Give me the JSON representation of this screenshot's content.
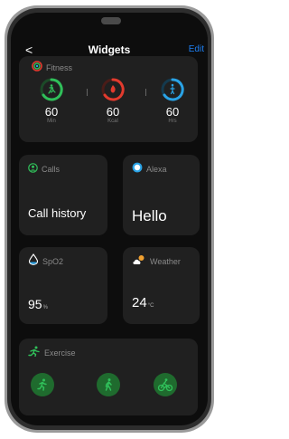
{
  "header": {
    "back_label": "<",
    "title": "Widgets",
    "edit_label": "Edit"
  },
  "fitness": {
    "label": "Fitness",
    "metrics": [
      {
        "name": "steps",
        "value": "60",
        "unit": "Min",
        "color": "#30c05a",
        "icon": "running-icon"
      },
      {
        "name": "calories",
        "value": "60",
        "unit": "Kcal",
        "color": "#e23b2e",
        "icon": "flame-icon"
      },
      {
        "name": "stand",
        "value": "60",
        "unit": "Hrs",
        "color": "#2aa3e6",
        "icon": "standing-icon"
      }
    ]
  },
  "calls": {
    "label": "Calls",
    "text": "Call history"
  },
  "alexa": {
    "label": "Alexa",
    "text": "Hello"
  },
  "spo2": {
    "label": "SpO2",
    "value": "95",
    "unit": "%"
  },
  "weather": {
    "label": "Weather",
    "value": "24",
    "unit": "°C"
  },
  "exercise": {
    "label": "Exercise",
    "activities": [
      "running-icon",
      "walking-icon",
      "cycling-icon"
    ]
  },
  "colors": {
    "accent": "#1d7ff2",
    "card": "#202020",
    "background": "#0d0d0d",
    "exercise_green": "#1f6b2e"
  }
}
